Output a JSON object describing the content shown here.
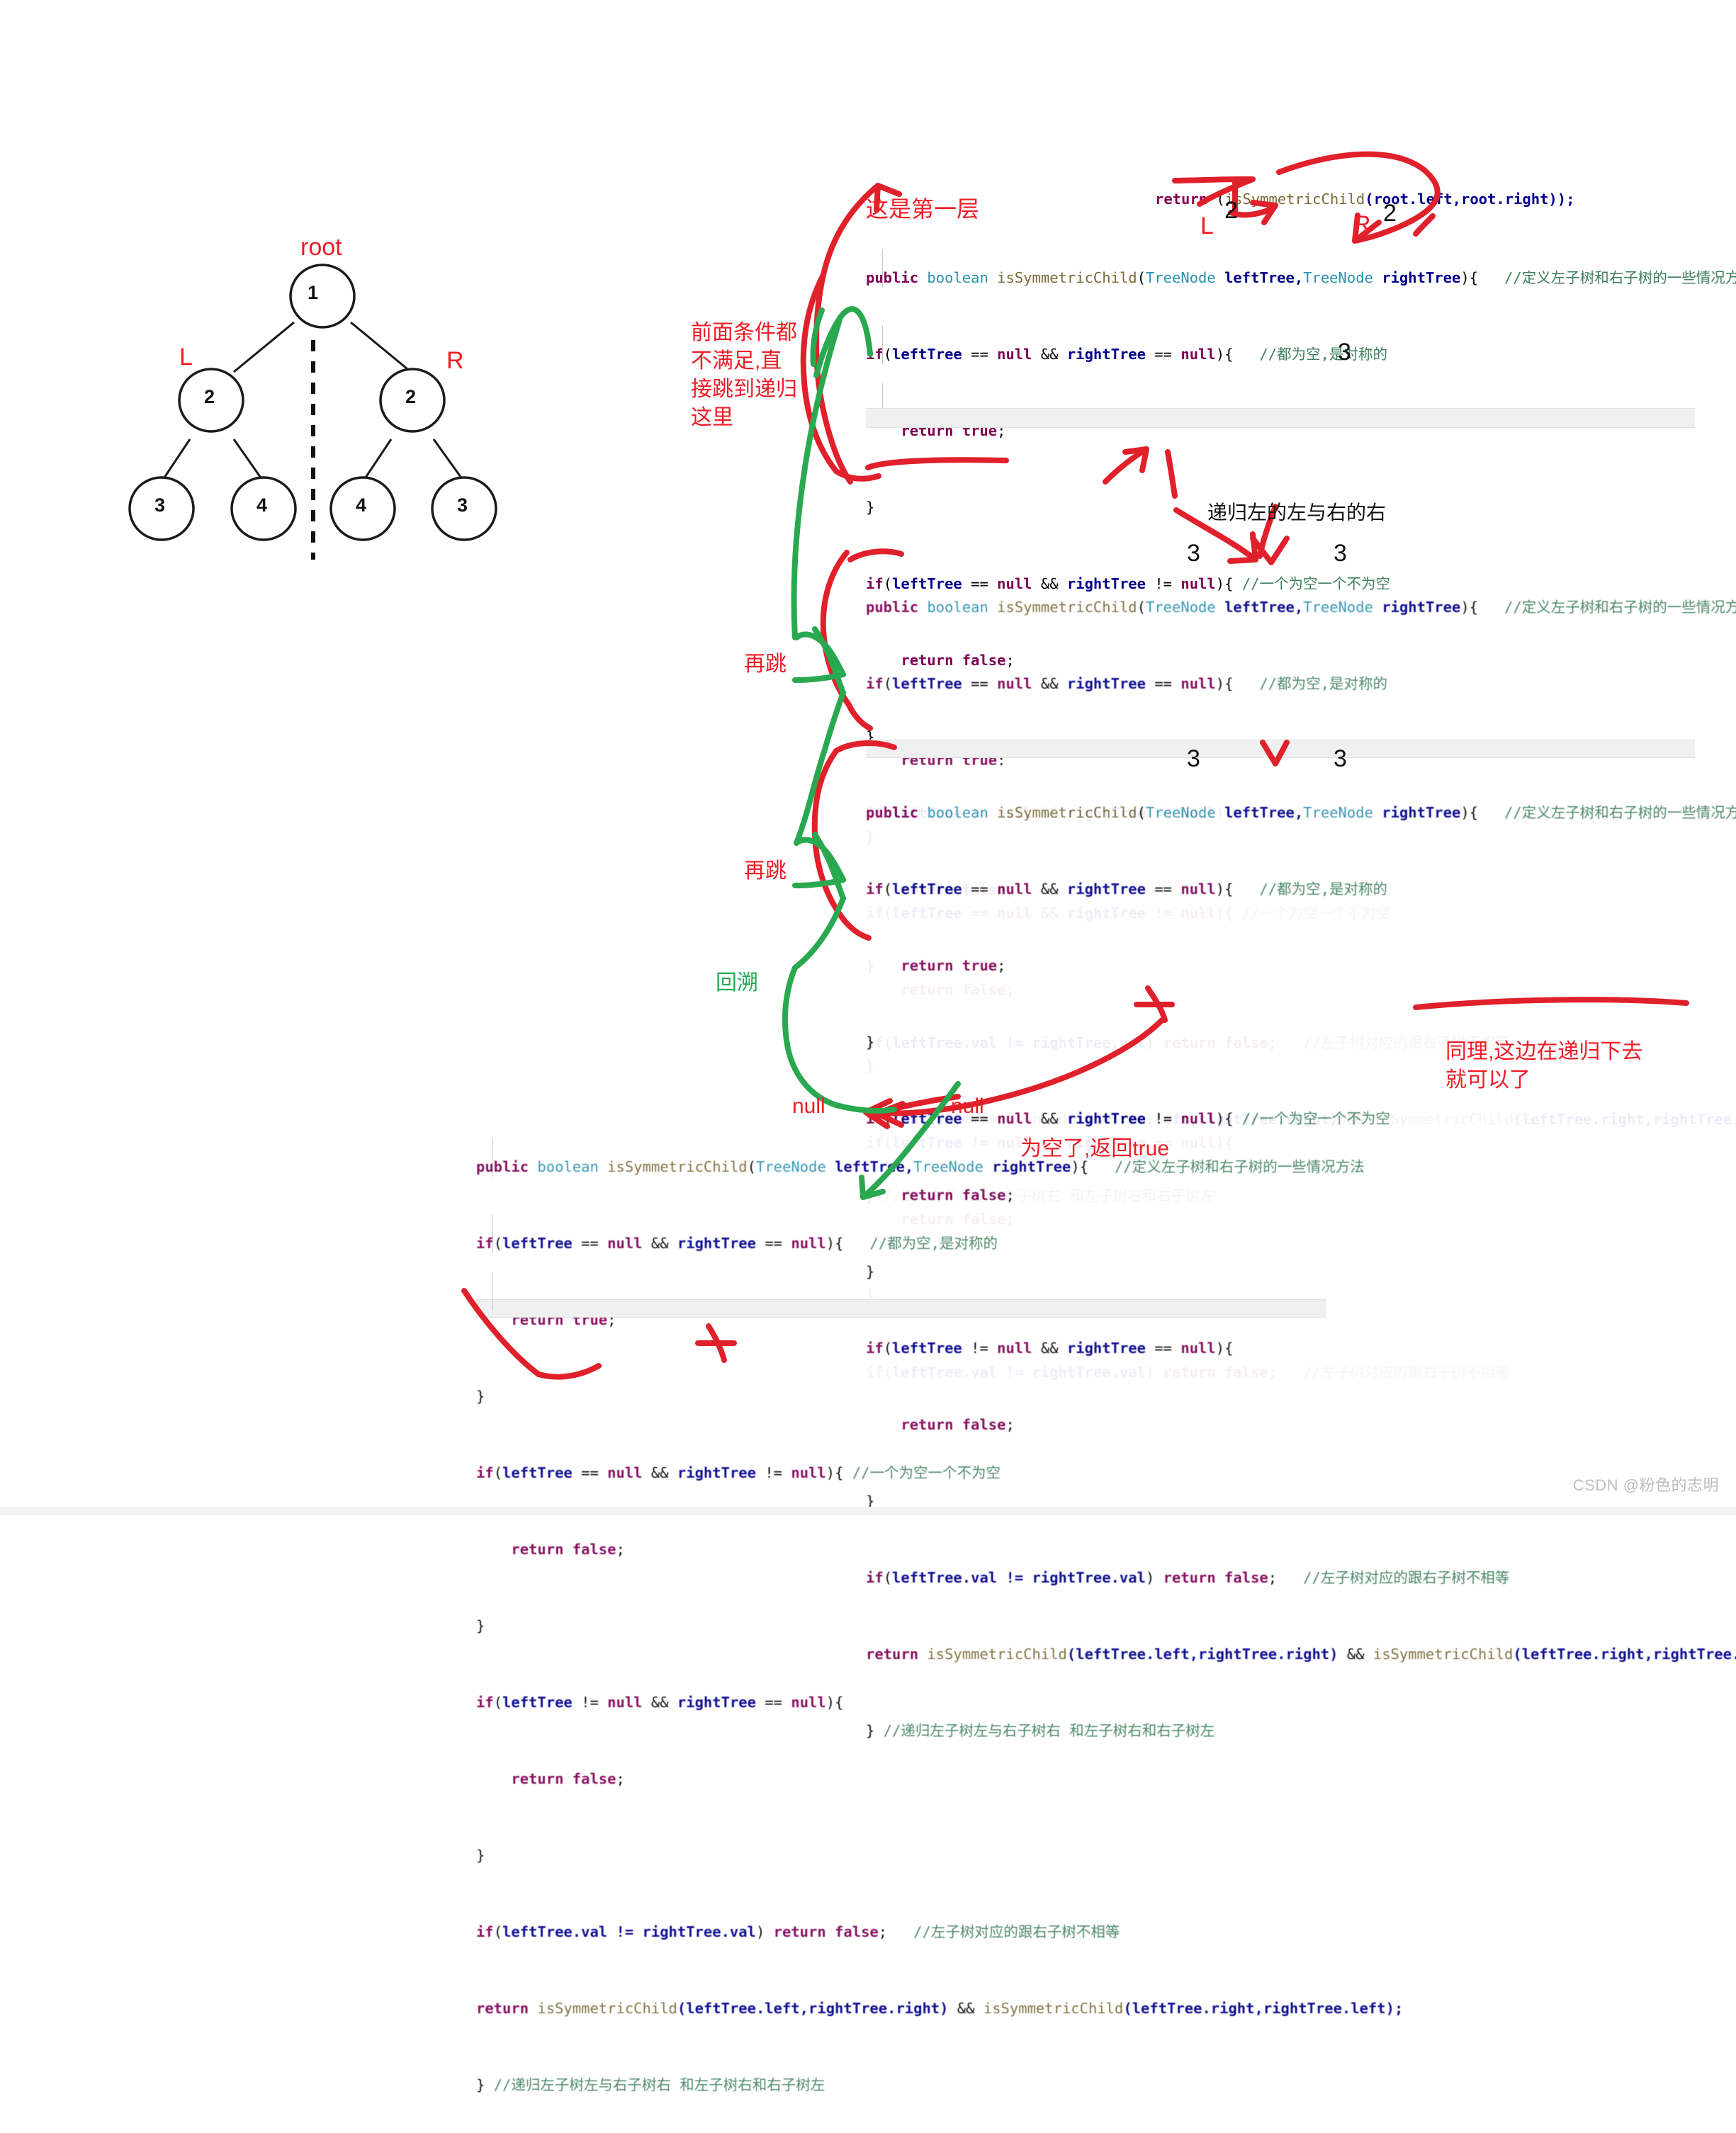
{
  "tree": {
    "root_label": "root",
    "left_label": "L",
    "right_label": "R",
    "nodes": {
      "root": "1",
      "l1": "2",
      "r1": "2",
      "l2a": "3",
      "l2b": "4",
      "r2a": "4",
      "r2b": "3"
    }
  },
  "colors": {
    "annotation_red": "#ee1c25",
    "annotation_green": "#22aa55",
    "keyword": "#7f0055",
    "type": "#2b91af",
    "method": "#7a6a35",
    "identifier": "#00008b",
    "comment": "#3f7f5f"
  },
  "top_return": {
    "kw": "return",
    "rest": " (",
    "method": "isSymmetricChild",
    "args": "(root.left,root.right));"
  },
  "annotations": {
    "first_layer": "这是第一层",
    "conditions_note": "前面条件都\n不满足,直\n接跳到递归\n这里",
    "recurse_left_left": "递归左的左与右的右",
    "jump_again_1": "再跳",
    "jump_again_2": "再跳",
    "backtrack": "回溯",
    "same_recursion": "同理,这边在递归下去\n就可以了",
    "empty_return_true": "为空了,返回true",
    "L": "L",
    "R": "R",
    "two_a": "2",
    "two_b": "2",
    "three_b1_left": "3",
    "three_b2_left": "3",
    "three_b2_right": "3",
    "three_b3_left": "3",
    "three_b3_right": "3",
    "null_left": "null",
    "null_right": "null"
  },
  "code_lines": {
    "signature": {
      "kw_public": "public",
      "kw_boolean": "boolean",
      "method": "isSymmetricChild",
      "p1": "(",
      "t1": "TreeNode",
      "a1": " leftTree,",
      "t2": "TreeNode",
      "a2": " rightTree",
      "p2": "){",
      "comment": "   //定义左子树和右子树的一些情况方法"
    },
    "if_both_null": {
      "kw": "if",
      "open": "(",
      "v1": "leftTree",
      "eq1": " == ",
      "n1": "null",
      "and": " && ",
      "v2": "rightTree",
      "eq2": " == ",
      "n2": "null",
      "close": "){",
      "comment": "   //都为空,是对称的"
    },
    "return_true": {
      "kw": "return",
      "val": "true",
      "semi": ";"
    },
    "close_brace": "}",
    "if_left_null": {
      "kw": "if",
      "open": "(",
      "v1": "leftTree",
      "eq1": " == ",
      "n1": "null",
      "and": " && ",
      "v2": "rightTree",
      "eq2": " != ",
      "n2": "null",
      "close": "){",
      "comment": " //一个为空一个不为空"
    },
    "return_false": {
      "kw": "return",
      "val": "false",
      "semi": ";"
    },
    "if_right_null": {
      "kw": "if",
      "open": "(",
      "v1": "leftTree",
      "eq1": " != ",
      "n1": "null",
      "and": " && ",
      "v2": "rightTree",
      "eq2": " == ",
      "n2": "null",
      "close": "){"
    },
    "if_val_neq": {
      "kw": "if",
      "open": "(",
      "expr": "leftTree.val != rightTree.val",
      "close": ") ",
      "kw2": "return",
      "val": " false",
      "semi": ";",
      "comment": "   //左子树对应的跟右子树不相等"
    },
    "return_recurse": {
      "kw": "return",
      "m1": "isSymmetricChild",
      "a1": "(leftTree.left,rightTree.right)",
      "and": " && ",
      "m2": "isSymmetricChild",
      "a2": "(leftTree.right,rightTree.left);"
    },
    "close_comment": {
      "brace": "} ",
      "comment": "//递归左子树左与右子树右 和左子树右和右子树左"
    }
  },
  "watermark": "CSDN @粉色的志明"
}
